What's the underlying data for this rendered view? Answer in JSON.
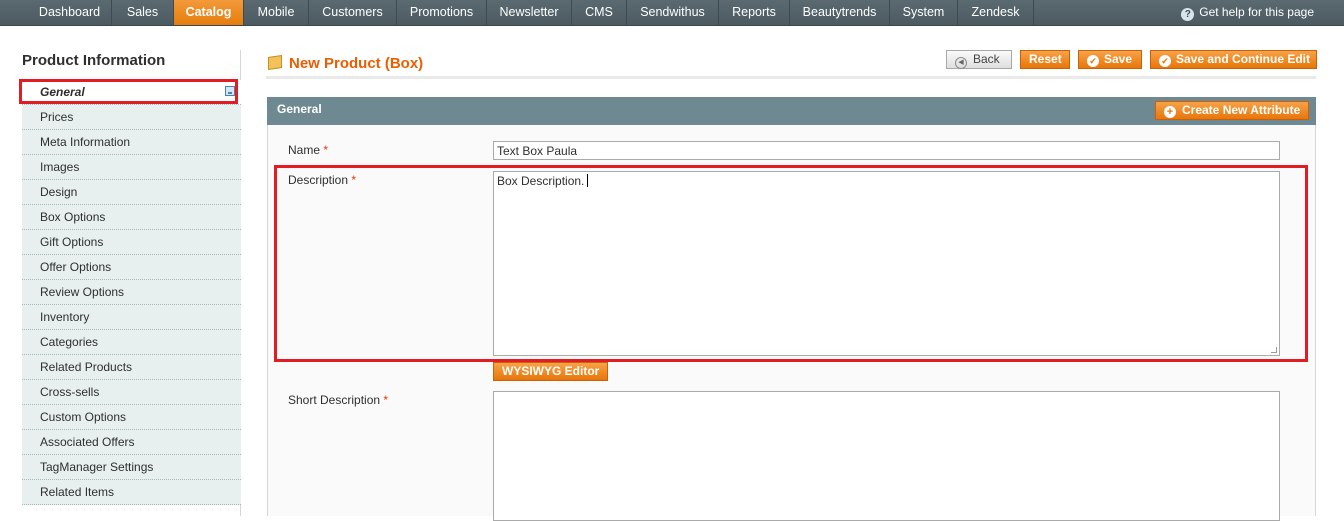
{
  "nav": {
    "items": [
      {
        "label": "Dashboard"
      },
      {
        "label": "Sales"
      },
      {
        "label": "Catalog",
        "active": true
      },
      {
        "label": "Mobile"
      },
      {
        "label": "Customers"
      },
      {
        "label": "Promotions"
      },
      {
        "label": "Newsletter"
      },
      {
        "label": "CMS"
      },
      {
        "label": "Sendwithus"
      },
      {
        "label": "Reports"
      },
      {
        "label": "Beautytrends"
      },
      {
        "label": "System"
      },
      {
        "label": "Zendesk"
      }
    ],
    "help": "Get help for this page"
  },
  "sidebar": {
    "title": "Product Information",
    "items": [
      {
        "label": "General",
        "active": true
      },
      {
        "label": "Prices"
      },
      {
        "label": "Meta Information"
      },
      {
        "label": "Images"
      },
      {
        "label": "Design"
      },
      {
        "label": "Box Options"
      },
      {
        "label": "Gift Options"
      },
      {
        "label": "Offer Options"
      },
      {
        "label": "Review Options"
      },
      {
        "label": "Inventory"
      },
      {
        "label": "Categories"
      },
      {
        "label": "Related Products"
      },
      {
        "label": "Cross-sells"
      },
      {
        "label": "Custom Options"
      },
      {
        "label": "Associated Offers"
      },
      {
        "label": "TagManager Settings"
      },
      {
        "label": "Related Items"
      }
    ]
  },
  "header": {
    "title": "New Product (Box)",
    "back": "Back",
    "reset": "Reset",
    "save": "Save",
    "save_continue": "Save and Continue Edit"
  },
  "fieldset": {
    "title": "General",
    "create_attribute": "Create New Attribute",
    "required_mark": "*",
    "name_label": "Name",
    "name_value": "Text Box Paula",
    "description_label": "Description",
    "description_value": "Box Description.",
    "wysiwyg": "WYSIWYG Editor",
    "short_description_label": "Short Description",
    "short_description_value": ""
  },
  "colors": {
    "accent": "#eb5e00",
    "nav_bg": "#4b5b61",
    "highlight": "#e21c23"
  }
}
